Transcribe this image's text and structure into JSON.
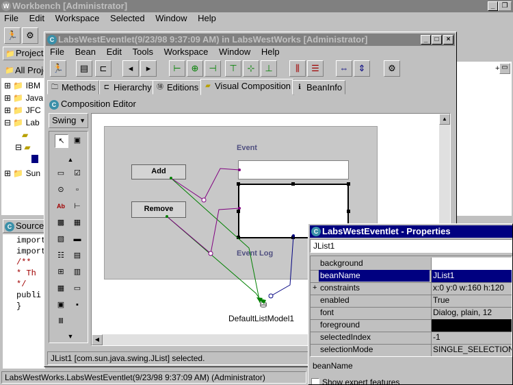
{
  "outer": {
    "title": "Workbench [Administrator]",
    "menu": [
      "File",
      "Edit",
      "Workspace",
      "Selected",
      "Window",
      "Help"
    ],
    "panes": {
      "projects_tab": "Projects",
      "all_projects": "All Projects",
      "source_tab": "Source"
    },
    "tree": [
      "IBM",
      "Java",
      "JFC",
      "Lab",
      "Sun"
    ],
    "code": [
      "import",
      "import",
      "/**",
      " * Th",
      " */",
      "publi",
      "}"
    ],
    "status": "LabsWestWorks.LabsWestEventlet(9/23/98 9:37:09 AM) (Administrator)"
  },
  "inner": {
    "title": "LabsWestEventlet(9/23/98 9:37:09 AM) in LabsWestWorks [Administrator]",
    "menu": [
      "File",
      "Bean",
      "Edit",
      "Tools",
      "Workspace",
      "Window",
      "Help"
    ],
    "tabs": [
      "Methods",
      "Hierarchy",
      "Editions",
      "Visual Composition",
      "BeanInfo"
    ],
    "editor_label": "Composition Editor",
    "palette_category": "Swing",
    "status": "JList1 [com.sun.java.swing.JList] selected."
  },
  "canvas": {
    "add_button": "Add",
    "remove_button": "Remove",
    "event_label": "Event",
    "event_log_label": "Event Log",
    "model_label": "DefaultListModel1"
  },
  "properties": {
    "title": "LabsWestEventlet - Properties",
    "selected_bean": "JList1",
    "rows": [
      {
        "name": "background",
        "value": ""
      },
      {
        "name": "beanName",
        "value": "JList1"
      },
      {
        "name": "constraints",
        "value": "x:0 y:0 w:160 h:120"
      },
      {
        "name": "enabled",
        "value": "True"
      },
      {
        "name": "font",
        "value": "Dialog, plain, 12"
      },
      {
        "name": "foreground",
        "value": ""
      },
      {
        "name": "selectedIndex",
        "value": "-1"
      },
      {
        "name": "selectionMode",
        "value": "SINGLE_SELECTION"
      }
    ],
    "description": "beanName",
    "expert_label": "Show expert features"
  },
  "colors": {
    "titlebar_active": "#000080",
    "titlebar_inactive": "#808080",
    "connection_green": "#008000",
    "connection_purple": "#800080",
    "connection_navy": "#000080"
  }
}
